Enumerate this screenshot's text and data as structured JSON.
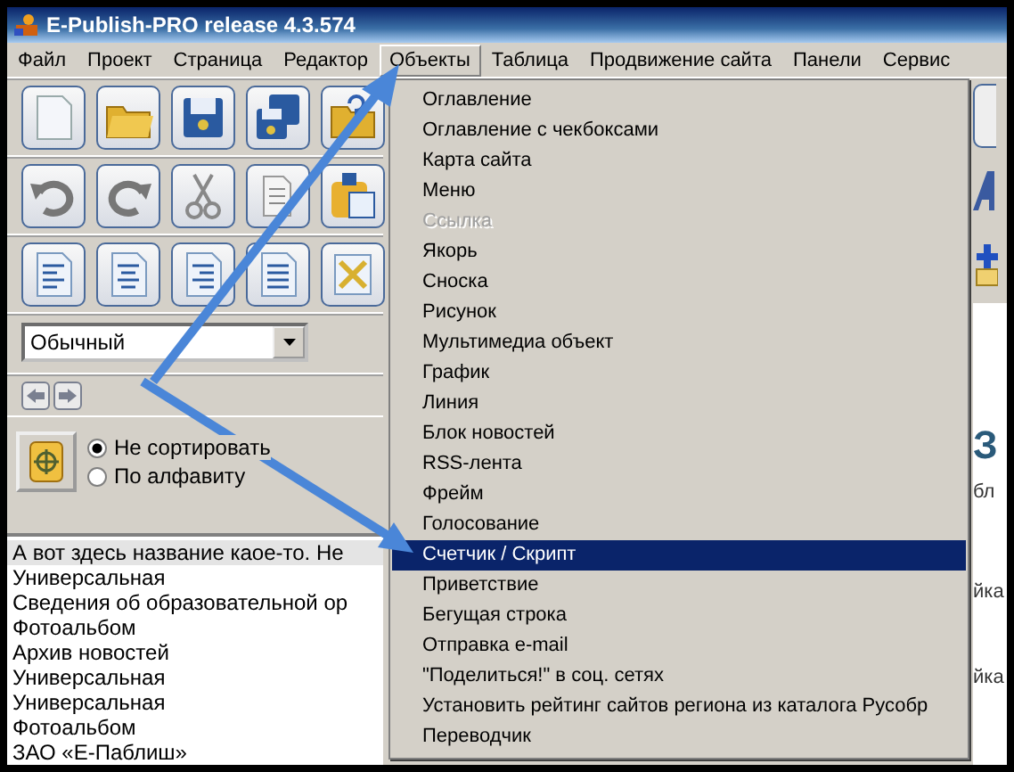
{
  "window": {
    "title": "E-Publish-PRO release 4.3.574"
  },
  "menu_bar": [
    {
      "label": "Файл",
      "selected": false
    },
    {
      "label": "Проект",
      "selected": false
    },
    {
      "label": "Страница",
      "selected": false
    },
    {
      "label": "Редактор",
      "selected": false
    },
    {
      "label": "Объекты",
      "selected": true
    },
    {
      "label": "Таблица",
      "selected": false
    },
    {
      "label": "Продвижение сайта",
      "selected": false
    },
    {
      "label": "Панели",
      "selected": false
    },
    {
      "label": "Сервис",
      "selected": false
    }
  ],
  "objects_menu": {
    "items": [
      {
        "label": "Оглавление",
        "disabled": false,
        "selected": false
      },
      {
        "label": "Оглавление с чекбоксами",
        "disabled": false,
        "selected": false
      },
      {
        "label": "Карта сайта",
        "disabled": false,
        "selected": false
      },
      {
        "label": "Меню",
        "disabled": false,
        "selected": false
      },
      {
        "label": "Ссылка",
        "disabled": true,
        "selected": false
      },
      {
        "label": "Якорь",
        "disabled": false,
        "selected": false
      },
      {
        "label": "Сноска",
        "disabled": false,
        "selected": false
      },
      {
        "label": "Рисунок",
        "disabled": false,
        "selected": false
      },
      {
        "label": "Мультимедиа объект",
        "disabled": false,
        "selected": false
      },
      {
        "label": "График",
        "disabled": false,
        "selected": false
      },
      {
        "label": "Линия",
        "disabled": false,
        "selected": false
      },
      {
        "label": "Блок новостей",
        "disabled": false,
        "selected": false
      },
      {
        "label": "RSS-лента",
        "disabled": false,
        "selected": false
      },
      {
        "label": "Фрейм",
        "disabled": false,
        "selected": false
      },
      {
        "label": "Голосование",
        "disabled": false,
        "selected": false
      },
      {
        "label": "Счетчик / Скрипт",
        "disabled": false,
        "selected": true
      },
      {
        "label": "Приветствие",
        "disabled": false,
        "selected": false
      },
      {
        "label": "Бегущая строка",
        "disabled": false,
        "selected": false
      },
      {
        "label": "Отправка e-mail",
        "disabled": false,
        "selected": false
      },
      {
        "label": "\"Поделиться!\" в соц. сетях",
        "disabled": false,
        "selected": false
      },
      {
        "label": "Установить рейтинг сайтов региона из каталога Русобр",
        "disabled": false,
        "selected": false
      },
      {
        "label": "Переводчик",
        "disabled": false,
        "selected": false
      }
    ]
  },
  "style_select": {
    "value": "Обычный"
  },
  "sort_options": [
    {
      "label": "Не сортировать",
      "selected": true
    },
    {
      "label": "По алфавиту",
      "selected": false
    }
  ],
  "page_list": {
    "rows": [
      {
        "label": "А вот здесь название каое-то. Не",
        "selected": true
      },
      {
        "label": "Универсальная",
        "selected": false
      },
      {
        "label": "Сведения об образовательной ор",
        "selected": false
      },
      {
        "label": "Фотоальбом",
        "selected": false
      },
      {
        "label": "Архив новостей",
        "selected": false
      },
      {
        "label": "Универсальная",
        "selected": false
      },
      {
        "label": "Универсальная",
        "selected": false
      },
      {
        "label": "Фотоальбом",
        "selected": false
      },
      {
        "label": "ЗАО «Е-Паблиш»",
        "selected": false
      }
    ]
  },
  "page_fragments": [
    "З",
    "бл",
    "йка",
    "йка"
  ]
}
